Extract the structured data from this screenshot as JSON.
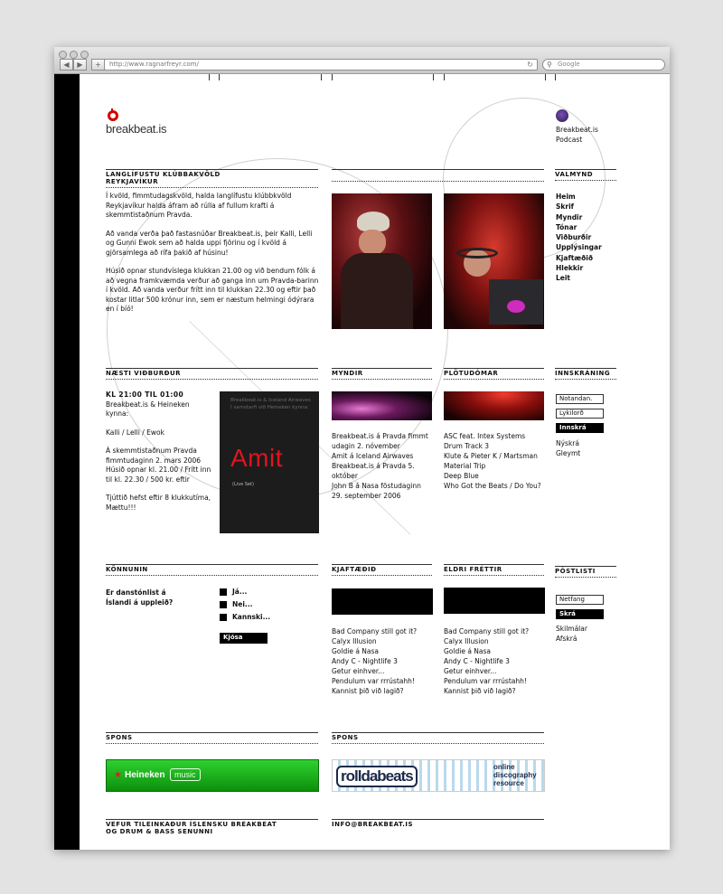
{
  "browser": {
    "url": "http://www.ragnarfreyr.com/",
    "search_placeholder": "Google",
    "back_label": "◀",
    "forward_label": "▶",
    "add_label": "+",
    "reload_label": "↻"
  },
  "brand": {
    "logo_text": "breakbeat.is",
    "accent": "#d50000"
  },
  "podcast": {
    "label_line1": "Breakbeat.is",
    "label_line2": "Podcast"
  },
  "intro": {
    "title_line1": "LANGLÍFUSTU KLÚBBAKVÖLD",
    "title_line2": "REYKJAVÍKUR",
    "p1": "Í kvöld, fimmtudagskvöld, halda langlífustu klúbbkvöld Reykjavíkur halda áfram að rúlla af fullum krafti á skemmtistaðnum Pravda.",
    "p2": "Að vanda verða það fastasnúðar Breakbeat.is, þeir Kalli, Lelli og Gunni Ewok sem að halda uppi fjörinu og í kvöld á gjörsamlega að rífa þakið af húsinu!",
    "p3": "Húsið opnar stundvíslega klukkan 21.00 og við bendum fólk á að vegna framkvæmda verður að ganga inn um Pravda-barinn í kvöld. Að vanda verður frítt inn til klukkan 22.30 og eftir það kostar litlar 500 krónur inn, sem er næstum helmingi ódýrara en í bíó!"
  },
  "menu": {
    "title": "VALMYND",
    "items": [
      "Heim",
      "Skrif",
      "Myndir",
      "Tónar",
      "Viðburðir",
      "Upplýsingar",
      "Kjaftæðið",
      "Hlekkir",
      "Leit"
    ]
  },
  "next_event": {
    "title": "NÆSTI VIÐBURÐUR",
    "time": "KL 21:00 TIL 01:00",
    "line1": "Breakbeat.is & Heineken kynna:",
    "line2": "Kalli / Lelli / Ewok",
    "line3": "Á skemmtistaðnum Pravda fimmtudaginn 2. mars 2006 Húsið opnar kl. 21.00 / Frítt inn til kl. 22.30 / 500 kr. eftir",
    "line4": "Tjúttið hefst eftir 8 klukkutíma, Mættu!!!"
  },
  "poster": {
    "header": "Breakbeat.is & Iceland Airwaves\nÍ samstarfi við Heineken kynna:",
    "artist": "Amit",
    "sub": "(Live Set)"
  },
  "myndir": {
    "title": "MYNDIR",
    "items": [
      "Breakbeat.is á Pravda fimmt udagin 2. nóvember",
      "Amit á Iceland Airwaves",
      "Breakbeat.is á Pravda 5. október",
      "John B á Nasa föstudaginn 29. september 2006"
    ]
  },
  "plotudomar": {
    "title": "PLÖTUDÓMAR",
    "items": [
      "ASC feat. Intex Systems Drum Track 3",
      "Klute & Pieter K / Martsman Material Trip",
      "Deep Blue",
      "Who Got the Beats / Do You?"
    ]
  },
  "login": {
    "title": "INNSKRÁNING",
    "username_placeholder": "Notandan.",
    "password_placeholder": "Lykilorð",
    "submit": "Innskrá",
    "register": "Nýskrá",
    "forgot": "Gleymt"
  },
  "poll": {
    "title": "KÖNNUNIN",
    "question": "Er danstónlist á Íslandi á uppleið?",
    "options": [
      "Já...",
      "Nei...",
      "Kannski..."
    ],
    "vote": "Kjósa"
  },
  "kjaftaedid": {
    "title": "KJAFTÆÐIÐ",
    "items": [
      "Bad Company still got it?",
      "Calyx Illusion",
      "Goldie á Nasa",
      "Andy C - Nightlife 3",
      "Getur einhver...",
      "Pendulum var rrrústahh!",
      "Kannist  þið við lagið?"
    ]
  },
  "eldri": {
    "title": "ELDRI FRÉTTIR",
    "items": [
      "Bad Company still got it?",
      "Calyx Illusion",
      "Goldie á Nasa",
      "Andy C - Nightlife 3",
      "Getur einhver...",
      "Pendulum var rrrústahh!",
      "Kannist  þið við lagið?"
    ]
  },
  "mailing": {
    "title": "PÓSTLISTI",
    "email_placeholder": "Netfang",
    "submit": "Skrá",
    "terms": "Skilmálar",
    "unsubscribe": "Afskrá"
  },
  "spons": {
    "title_left": "SPONS",
    "title_right": "SPONS",
    "heineken_text": "Heineken",
    "heineken_music": "music",
    "rolldabeats_text": "rolldabeats",
    "rolldabeats_tag1": "online",
    "rolldabeats_tag2": "discography",
    "rolldabeats_tag3": "resource"
  },
  "footer": {
    "left_line1": "VEFUR TILEINKAÐUR ÍSLENSKU BREAKBEAT",
    "left_line2": "OG DRUM & BASS SENUNNI",
    "email": "INFO@BREAKBEAT.IS"
  }
}
